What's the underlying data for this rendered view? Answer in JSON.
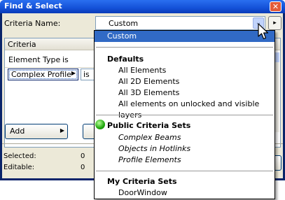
{
  "window": {
    "title": "Find & Select",
    "close_glyph": "✕"
  },
  "criteria_name": {
    "label": "Criteria Name:",
    "value": "Custom",
    "arrow_glyph": "⌄",
    "next_glyph": "▸"
  },
  "criteria_panel": {
    "header": "Criteria",
    "rows": [
      {
        "property": "Element Type",
        "operator": "is"
      },
      {
        "property": "Complex Profile",
        "operator": "is"
      }
    ],
    "arrow_glyph": "▶"
  },
  "buttons": {
    "add_label": "Add",
    "add_arrow": "▶"
  },
  "status": {
    "selected_label": "Selected:",
    "selected_value": "0",
    "editable_label": "Editable:",
    "editable_value": "0"
  },
  "dropdown": {
    "items": [
      {
        "label": "Custom",
        "selected": true
      },
      {
        "label": "Defaults",
        "header": true
      },
      {
        "label": "All Elements"
      },
      {
        "label": "All 2D Elements"
      },
      {
        "label": "All 3D Elements"
      },
      {
        "label": "All elements on unlocked and visible layers"
      },
      {
        "label": "Public Criteria Sets",
        "header": true
      },
      {
        "label": "Complex Beams",
        "italic": true
      },
      {
        "label": "Objects in Hotlinks",
        "italic": true
      },
      {
        "label": "Profile Elements",
        "italic": true
      },
      {
        "label": "My Criteria Sets",
        "header": true
      },
      {
        "label": "DoorWindow"
      }
    ]
  },
  "colors": {
    "title_bar": "#1451d8",
    "selection": "#316ac5",
    "dialog_bg": "#ece9d8",
    "public_set_icon": "#1fa70c"
  },
  "icons": [
    "close-icon",
    "dropdown-arrow-icon",
    "next-arrow-icon",
    "green-ball-icon",
    "mouse-cursor-icon"
  ]
}
